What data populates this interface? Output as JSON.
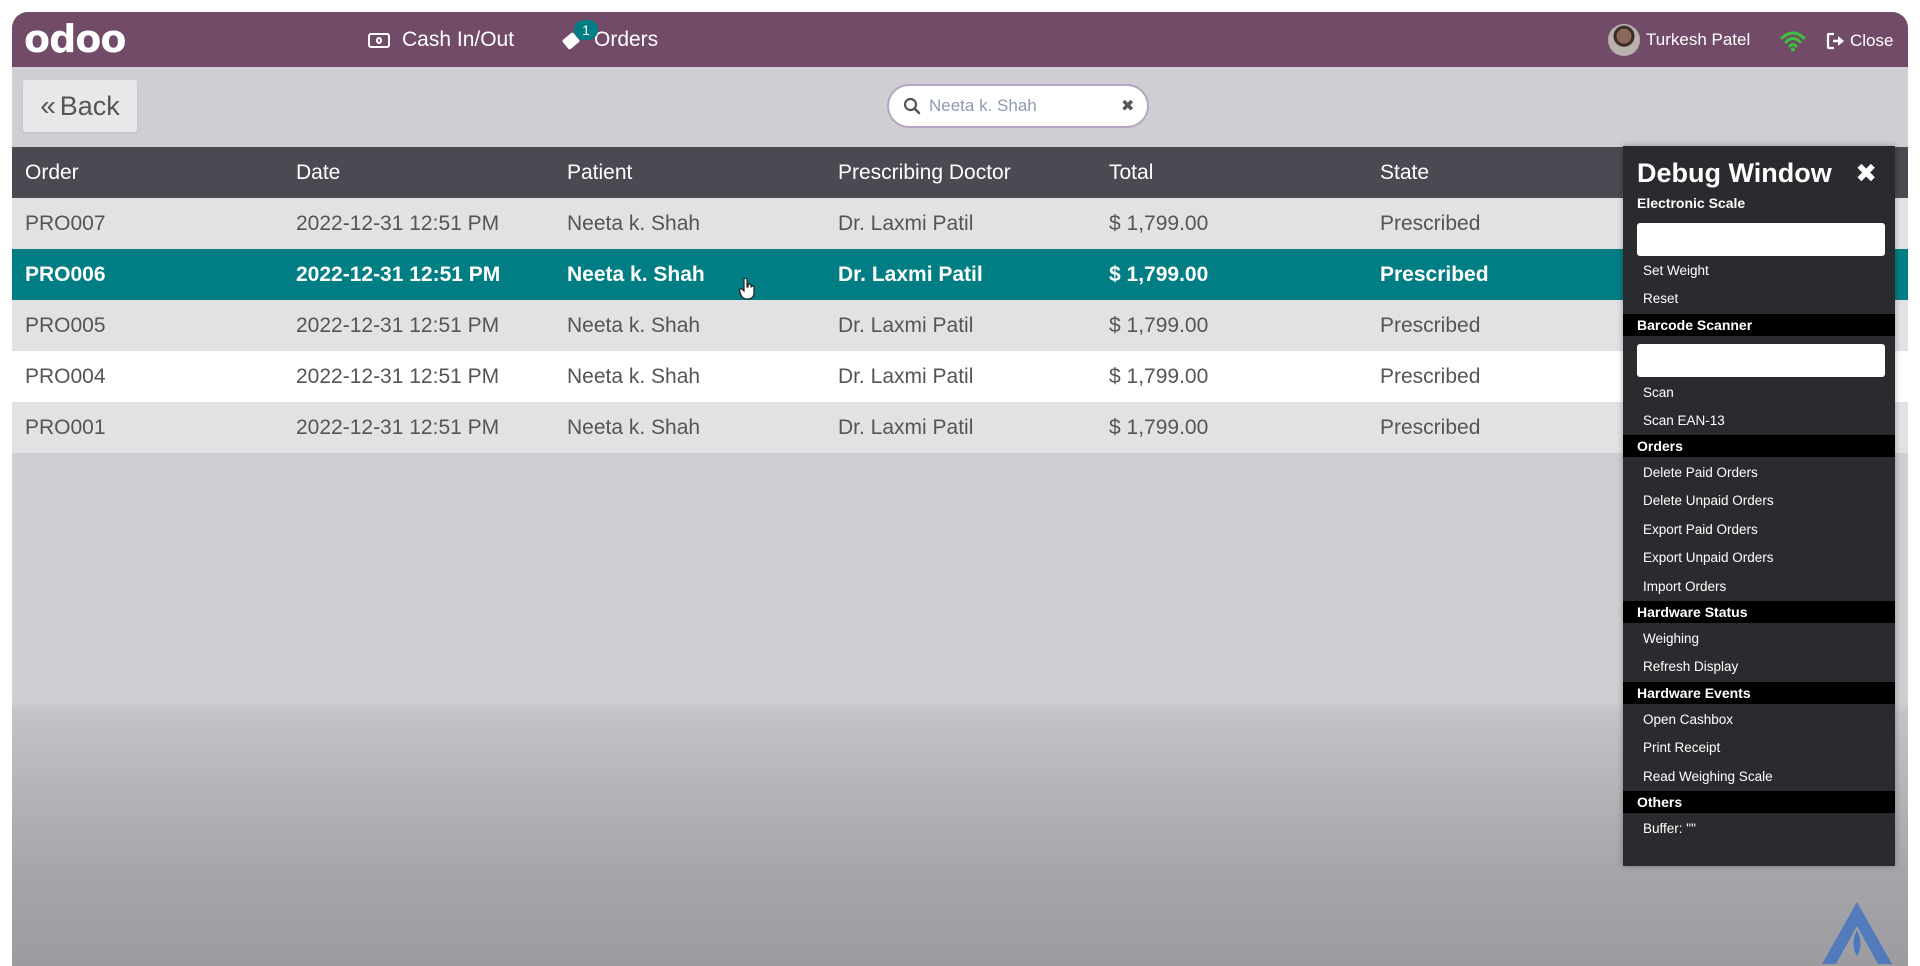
{
  "topbar": {
    "logo": "odoo",
    "cash_label": "Cash In/Out",
    "orders_label": "Orders",
    "orders_badge": "1",
    "user_name": "Turkesh Patel",
    "close_label": "Close"
  },
  "controls": {
    "back_label": "Back",
    "search_value": "Neeta k. Shah"
  },
  "table": {
    "headers": [
      "Order",
      "Date",
      "Patient",
      "Prescribing Doctor",
      "Total",
      "State"
    ],
    "rows": [
      {
        "order": "PRO007",
        "date": "2022-12-31 12:51 PM",
        "patient": "Neeta k. Shah",
        "doctor": "Dr. Laxmi Patil",
        "total": "$ 1,799.00",
        "state": "Prescribed"
      },
      {
        "order": "PRO006",
        "date": "2022-12-31 12:51 PM",
        "patient": "Neeta k. Shah",
        "doctor": "Dr. Laxmi Patil",
        "total": "$ 1,799.00",
        "state": "Prescribed"
      },
      {
        "order": "PRO005",
        "date": "2022-12-31 12:51 PM",
        "patient": "Neeta k. Shah",
        "doctor": "Dr. Laxmi Patil",
        "total": "$ 1,799.00",
        "state": "Prescribed"
      },
      {
        "order": "PRO004",
        "date": "2022-12-31 12:51 PM",
        "patient": "Neeta k. Shah",
        "doctor": "Dr. Laxmi Patil",
        "total": "$ 1,799.00",
        "state": "Prescribed"
      },
      {
        "order": "PRO001",
        "date": "2022-12-31 12:51 PM",
        "patient": "Neeta k. Shah",
        "doctor": "Dr. Laxmi Patil",
        "total": "$ 1,799.00",
        "state": "Prescribed"
      }
    ],
    "selected_row": "PRO006"
  },
  "debug": {
    "title": "Debug Window",
    "sections": {
      "electronic_scale": "Electronic Scale",
      "set_weight": "Set Weight",
      "reset": "Reset",
      "barcode_scanner": "Barcode Scanner",
      "scan": "Scan",
      "scan_ean": "Scan EAN-13",
      "orders": "Orders",
      "delete_paid": "Delete Paid Orders",
      "delete_unpaid": "Delete Unpaid Orders",
      "export_paid": "Export Paid Orders",
      "export_unpaid": "Export Unpaid Orders",
      "import_orders": "Import Orders",
      "hardware_status": "Hardware Status",
      "weighing": "Weighing",
      "refresh_display": "Refresh Display",
      "hardware_events": "Hardware Events",
      "open_cashbox": "Open Cashbox",
      "print_receipt": "Print Receipt",
      "read_weighing": "Read Weighing Scale",
      "others": "Others",
      "buffer": "Buffer: \"\""
    }
  },
  "colors": {
    "topbar": "#714b67",
    "selected_row": "#017e84",
    "header_row": "#4a4a52",
    "wifi": "#3fbf3f"
  },
  "icons": [
    "cash-icon",
    "tag-icon",
    "avatar",
    "wifi-icon",
    "sign-out-icon",
    "search-icon",
    "close-icon",
    "hand-cursor-icon",
    "watermark-logo"
  ]
}
